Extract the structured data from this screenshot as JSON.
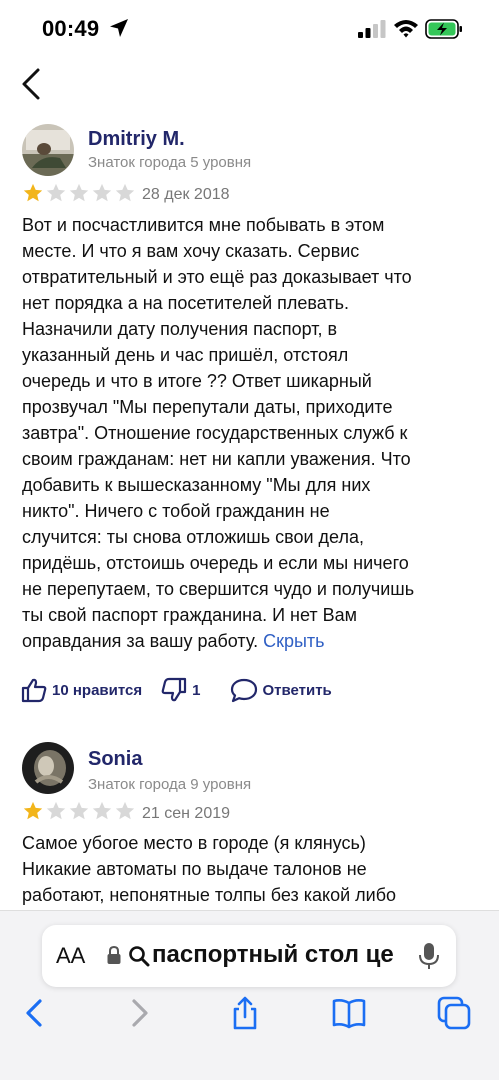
{
  "status": {
    "time": "00:49",
    "icons": [
      "location-arrow-icon",
      "signal-icon",
      "wifi-icon",
      "battery-charging-icon"
    ]
  },
  "nav": {
    "back_icon": "chevron-left-icon"
  },
  "reviews": [
    {
      "author": "Dmitriy M.",
      "level": "Знаток города 5 уровня",
      "rating": 1,
      "max_rating": 5,
      "date": "28 дек 2018",
      "lines": [
        "Вот и посчастливится мне побывать в этом",
        "месте. И что я вам хочу сказать. Сервис",
        "отвратительный и это ещё раз доказывает что",
        "нет порядка а на посетителей плевать.",
        "Назначили дату получения паспорт, в",
        "указанный день и час пришёл, отстоял",
        "очередь и что в итоге ?? Ответ шикарный",
        "прозвучал \"Мы перепутали даты, приходите",
        "завтра\". Отношение государственных служб к",
        "своим гражданам: нет ни капли уважения. Что",
        "добавить к вышесказанному \"Мы для них",
        "никто\". Ничего с тобой гражданин не",
        "случится: ты снова отложишь свои дела,",
        "придёшь, отстоишь очередь и если мы ничего",
        "не перепутаем, то свершится чудо и получишь",
        "ты свой паспорт гражданина. И нет Вам",
        "оправдания за вашу работу."
      ],
      "hide_label": "Скрыть",
      "likes_label": "10 нравится",
      "dislikes_count": "1",
      "reply_label": "Ответить"
    },
    {
      "author": "Sonia",
      "level": "Знаток города 9 уровня",
      "rating": 1,
      "max_rating": 5,
      "date": "21 сен 2019",
      "lines": [
        "Самое убогое место в городе (я клянусь)",
        "Никакие автоматы по выдаче талонов не",
        "работают, непонятные толпы без какой либо"
      ]
    }
  ],
  "colors": {
    "author": "#22276a",
    "star_filled": "#f2b51b",
    "star_empty": "#d8d8d8",
    "link": "#2f5fc4",
    "ios_blue": "#1b6ef3"
  },
  "browser": {
    "aa_label": "AA",
    "url_text": "паспортный стол це",
    "toolbar": [
      "back-icon",
      "forward-icon",
      "share-icon",
      "bookmarks-icon",
      "tabs-icon"
    ]
  }
}
